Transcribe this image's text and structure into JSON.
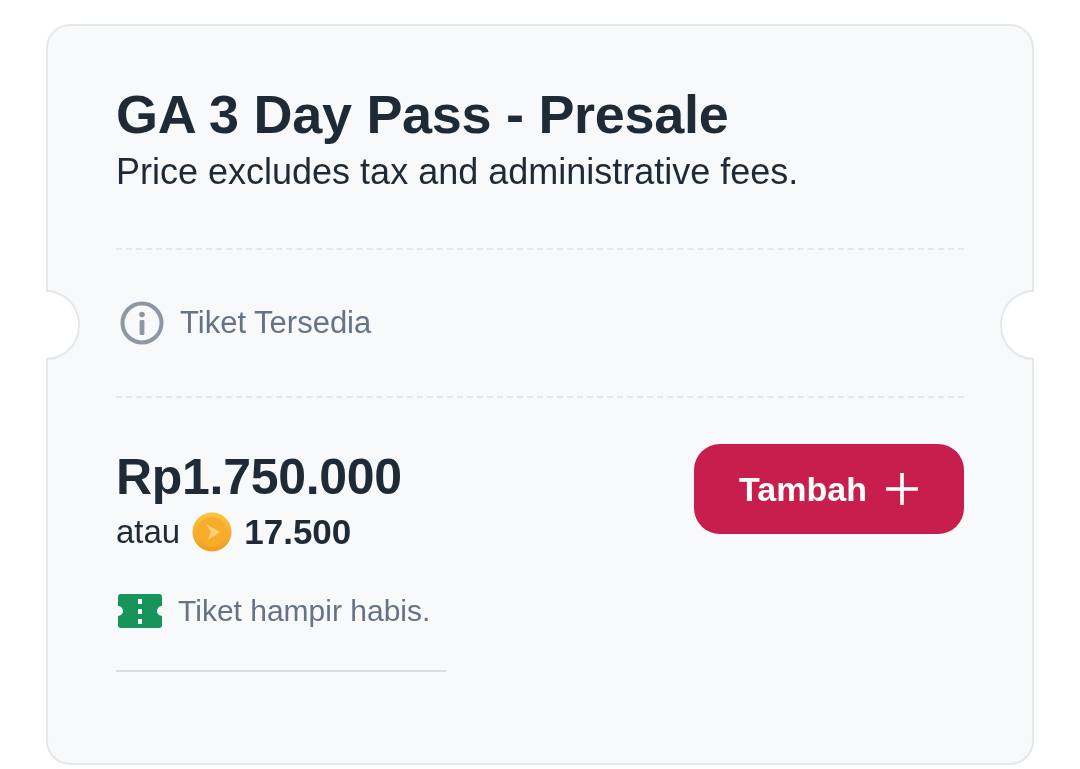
{
  "ticket": {
    "title": "GA 3 Day Pass - Presale",
    "note": "Price excludes tax and administrative fees.",
    "availability": "Tiket Tersedia",
    "price": "Rp1.750.000",
    "alt_price": {
      "prefix": "atau",
      "points": "17.500"
    },
    "stock_notice": "Tiket hampir habis.",
    "add_button": {
      "label": "Tambah"
    }
  }
}
